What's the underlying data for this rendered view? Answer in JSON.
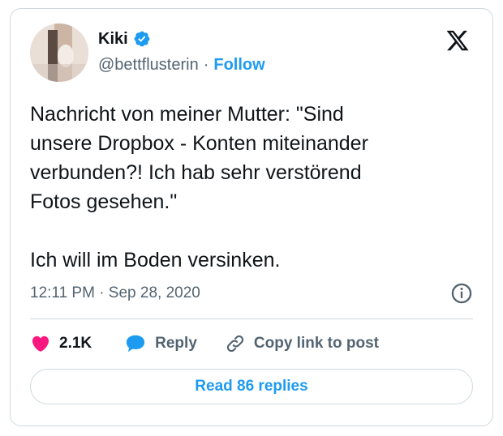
{
  "author": {
    "name": "Kiki",
    "handle": "@bettflusterin",
    "separator": "·",
    "follow_label": "Follow",
    "verified": true
  },
  "tweet": {
    "text": "Nachricht von meiner Mutter: \"Sind\nunsere Dropbox - Konten miteinander\nverbunden?! Ich hab sehr verstörend\nFotos gesehen.\"\n\nIch will im Boden versinken.",
    "timestamp": "12:11 PM · Sep 28, 2020"
  },
  "actions": {
    "likes_count": "2.1K",
    "reply_label": "Reply",
    "copy_link_label": "Copy link to post"
  },
  "read_replies_label": "Read 86 replies",
  "icons": {
    "logo": "x-logo-icon",
    "verified": "verified-badge-icon",
    "info": "info-icon",
    "like": "heart-icon",
    "reply": "speech-bubble-icon",
    "link": "link-icon"
  },
  "colors": {
    "accent": "#1d9bf0",
    "heart": "#f91880",
    "text": "#0f1419",
    "muted": "#536471",
    "border": "#cfd9de"
  }
}
